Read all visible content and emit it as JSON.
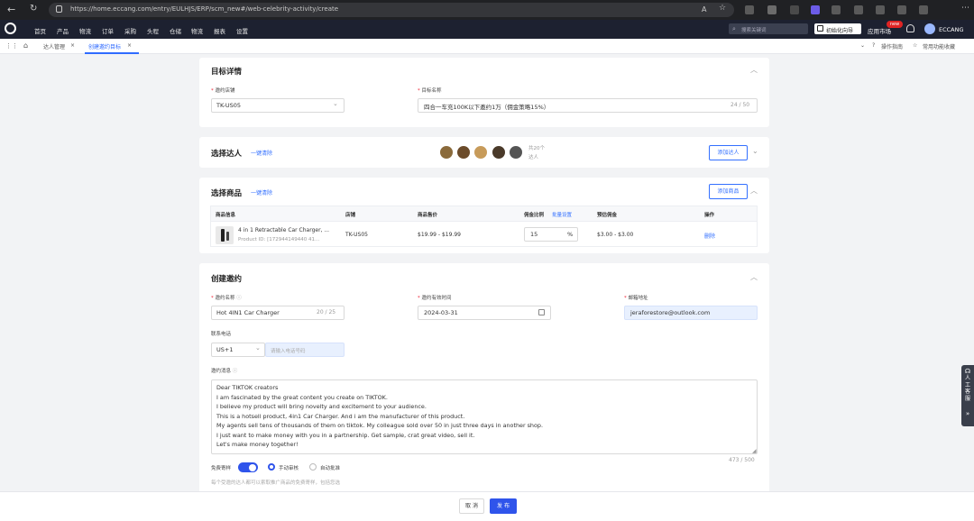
{
  "browser": {
    "url": "https://home.eccang.com/entry/EULHJS/ERP/scm_new#/web-celebrity-activity/create",
    "extension_colors": [
      "#5a5a5a",
      "#6b6b6b",
      "#4a4a4a",
      "#6c5ce7",
      "#5a5a5a",
      "#5a5a5a",
      "#5a5a5a",
      "#5a5a5a",
      "#5a5a5a"
    ]
  },
  "nav": {
    "items": [
      "首页",
      "产品",
      "物流",
      "订单",
      "采购",
      "头程",
      "仓储",
      "物流",
      "报表",
      "设置"
    ],
    "search_placeholder": "搜索关键词",
    "guide_label": "初始化向导",
    "app_market": "应用市场",
    "new_badge": "new",
    "user": "ECCANG"
  },
  "tabs": {
    "items": [
      "达人管理",
      "创建邀约目标"
    ],
    "right": [
      "操作指南",
      "常用功能收藏"
    ]
  },
  "target": {
    "title": "目标详情",
    "shop_label": "邀约店铺",
    "shop_value": "TK-US05",
    "name_label": "目标名称",
    "name_value": "四合一车充100K以下邀约1万（佣金策略15%）",
    "name_count": "24 / 50"
  },
  "influencer": {
    "title": "选择达人",
    "clear": "一键清除",
    "count": "共20个",
    "count_unit": "达人",
    "add": "添加达人",
    "avatar_colors": [
      "#8a6a3b",
      "#6b4b2a",
      "#c79b5a",
      "#4a3a2a",
      "#555555"
    ]
  },
  "product": {
    "title": "选择商品",
    "clear": "一键清除",
    "add": "添加商品",
    "headers": [
      "商品信息",
      "店铺",
      "商品售价",
      "佣金比例",
      "批量设置",
      "预估佣金",
      "操作"
    ],
    "row": {
      "name": "4 in 1 Retractable Car Charger, ...",
      "id": "Product ID: [172944149440 41...",
      "shop": "TK-US05",
      "price": "$19.99 - $19.99",
      "ratio": "15",
      "ratio_unit": "%",
      "commission": "$3.00 - $3.00",
      "action": "删除"
    }
  },
  "invite": {
    "title": "创建邀约",
    "name_label": "邀约名称",
    "name_value": "Hot 4IN1 Car Charger",
    "name_count": "20 / 25",
    "time_label": "邀约有效时间",
    "time_value": "2024-03-31",
    "email_label": "邮箱地址",
    "email_value": "jeraforestore@outlook.com",
    "phone_label": "联系电话",
    "phone_code": "US+1",
    "phone_placeholder": "请输入电话号码",
    "msg_label": "邀约消息",
    "message": "Dear TIKTOK creators\nI am fascinated by the great content you create on TIKTOK.\nI believe my product will bring novelty and excitement to your audience.\nThis is a hotsell product, 4in1 Car Charger. And i am the manufacturer of this product.\nMy agents sell tens of thousands of them on tiktok. My colleague sold over 50 in just three days in another shop.\nI just want to make money with you in a partnership. Get sample, crat great video, sell it.\nLet's make money together!",
    "msg_count": "473 / 500",
    "sample_label": "免费寄样",
    "opt_manual": "手动审核",
    "opt_auto": "自动批准",
    "hint": "每个受邀的达人都可以索取推广商品的免费寄样，包括您选"
  },
  "footer": {
    "cancel": "取 消",
    "publish": "发 布"
  },
  "side_widget": {
    "label": "人工客服"
  }
}
